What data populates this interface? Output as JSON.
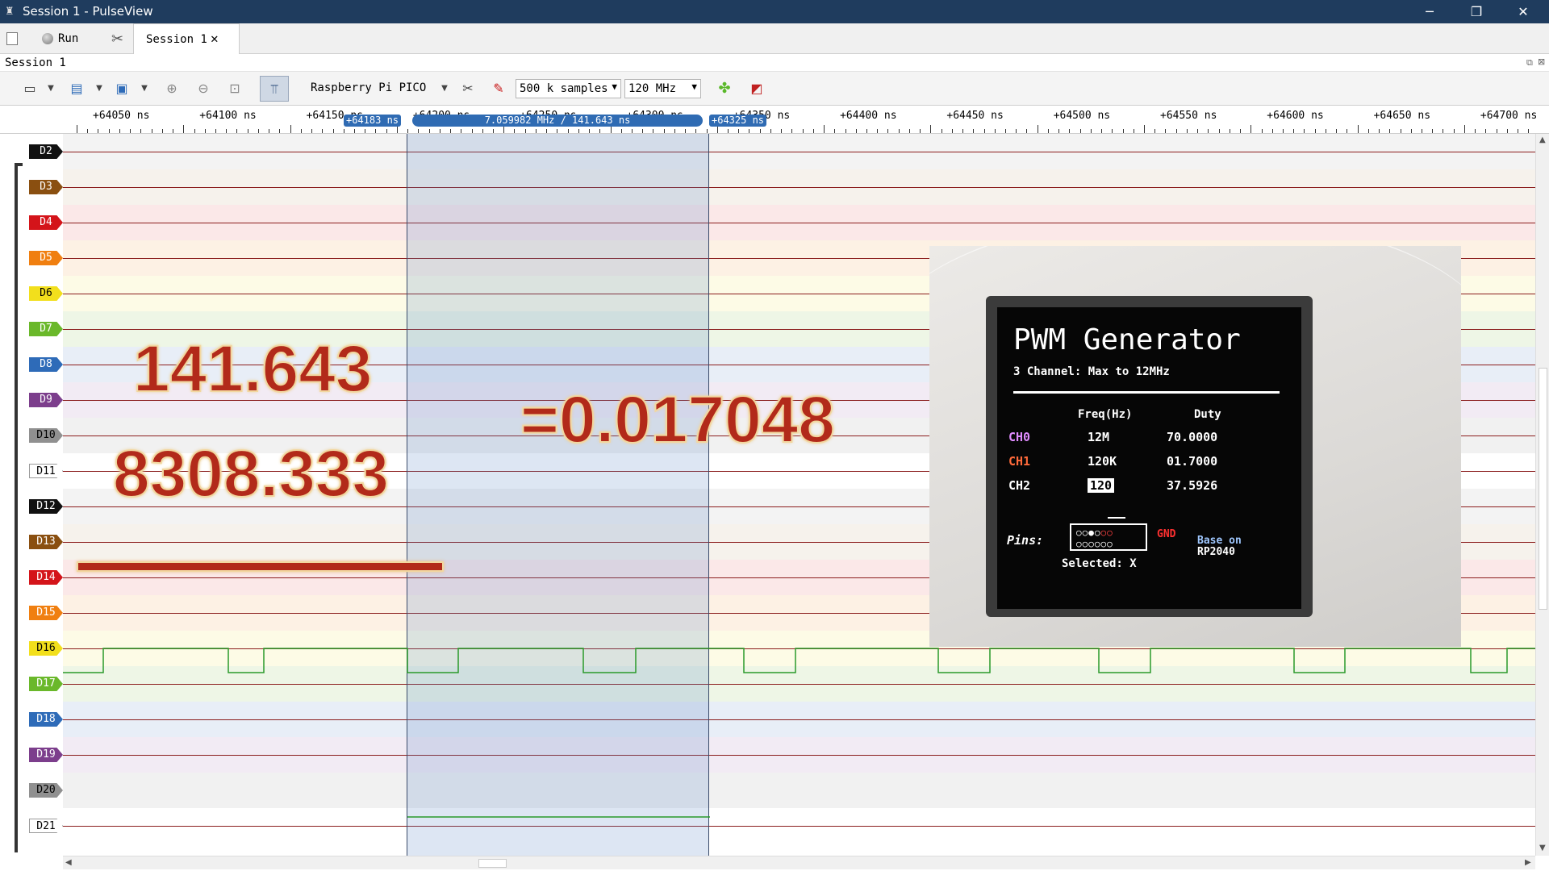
{
  "window": {
    "title": "Session 1 - PulseView",
    "minimize": "─",
    "restore": "❐",
    "close": "✕"
  },
  "tabbar": {
    "run_label": "Run",
    "session_tab": "Session 1",
    "session_close": "✕"
  },
  "session_label": "Session 1",
  "toolbar": {
    "device": "Raspberry Pi PICO",
    "samples": "500 k samples",
    "samplerate": "120 MHz"
  },
  "ruler": {
    "labels": [
      "+64050 ns",
      "+64100 ns",
      "+64150 ns",
      "+64200 ns",
      "+64250 ns",
      "+64300 ns",
      "+64350 ns",
      "+64400 ns",
      "+64450 ns",
      "+64500 ns",
      "+64550 ns",
      "+64600 ns",
      "+64650 ns",
      "+64700 ns"
    ],
    "cursor_left": "+64183 ns",
    "cursor_measure": "7.059982 MHz / 141.643 ns",
    "cursor_right": "+64325 ns"
  },
  "channels": [
    {
      "name": "D2",
      "bg": "#f3f3f3",
      "label_bg": "#111111",
      "label_fg": "#ffffff"
    },
    {
      "name": "D3",
      "bg": "#f6f2ec",
      "label_bg": "#8a4f10",
      "label_fg": "#ffffff"
    },
    {
      "name": "D4",
      "bg": "#fbe8e8",
      "label_bg": "#d4141a",
      "label_fg": "#ffffff"
    },
    {
      "name": "D5",
      "bg": "#fdf1e4",
      "label_bg": "#f07f10",
      "label_fg": "#ffffff"
    },
    {
      "name": "D6",
      "bg": "#fdfbe6",
      "label_bg": "#f2df1c",
      "label_fg": "#000000"
    },
    {
      "name": "D7",
      "bg": "#eef6e6",
      "label_bg": "#6ab82a",
      "label_fg": "#ffffff"
    },
    {
      "name": "D8",
      "bg": "#e8eef7",
      "label_bg": "#2e6bb8",
      "label_fg": "#ffffff"
    },
    {
      "name": "D9",
      "bg": "#f2ebf4",
      "label_bg": "#7c3e8c",
      "label_fg": "#ffffff"
    },
    {
      "name": "D10",
      "bg": "#f1f1f1",
      "label_bg": "#909090",
      "label_fg": "#000000"
    },
    {
      "name": "D11",
      "bg": "#ffffff",
      "label_bg": "#ffffff",
      "label_fg": "#000000"
    },
    {
      "name": "D12",
      "bg": "#f3f3f3",
      "label_bg": "#111111",
      "label_fg": "#ffffff"
    },
    {
      "name": "D13",
      "bg": "#f6f2ec",
      "label_bg": "#8a4f10",
      "label_fg": "#ffffff"
    },
    {
      "name": "D14",
      "bg": "#fbe8e8",
      "label_bg": "#d4141a",
      "label_fg": "#ffffff"
    },
    {
      "name": "D15",
      "bg": "#fdf1e4",
      "label_bg": "#f07f10",
      "label_fg": "#ffffff"
    },
    {
      "name": "D16",
      "bg": "#fdfbe6",
      "label_bg": "#f2df1c",
      "label_fg": "#000000"
    },
    {
      "name": "D17",
      "bg": "#eef6e6",
      "label_bg": "#6ab82a",
      "label_fg": "#ffffff"
    },
    {
      "name": "D18",
      "bg": "#e8eef7",
      "label_bg": "#2e6bb8",
      "label_fg": "#ffffff"
    },
    {
      "name": "D19",
      "bg": "#f2ebf4",
      "label_bg": "#7c3e8c",
      "label_fg": "#ffffff"
    },
    {
      "name": "D20",
      "bg": "#f1f1f1",
      "label_bg": "#909090",
      "label_fg": "#000000"
    },
    {
      "name": "D21",
      "bg": "#ffffff",
      "label_bg": "#ffffff",
      "label_fg": "#000000"
    }
  ],
  "overlay": {
    "numerator": "141.643",
    "denominator": "8308.333",
    "result": "=0.017048"
  },
  "photo": {
    "title": "PWM Generator",
    "subtitle": "3 Channel: Max to 12MHz",
    "col_freq": "Freq(Hz)",
    "col_duty": "Duty",
    "rows": [
      {
        "ch": "CH0",
        "freq": "12M",
        "duty": "70.0000",
        "color": "#e08cff"
      },
      {
        "ch": "CH1",
        "freq": "120K",
        "duty": "01.7000",
        "color": "#ff6a3a"
      },
      {
        "ch": "CH2",
        "freq": "120",
        "duty": "37.5926",
        "color": "#ffffff"
      }
    ],
    "pins_label": "Pins:",
    "gnd": "GND",
    "base_on": "Base on",
    "chip": "RP2040",
    "selected": "Selected: X"
  },
  "colors": {
    "titlebar": "#1f3c5e",
    "cursor": "#2f6bb3",
    "signal_high": "#2a9a2a",
    "signal_idle": "#8b1d1d"
  }
}
